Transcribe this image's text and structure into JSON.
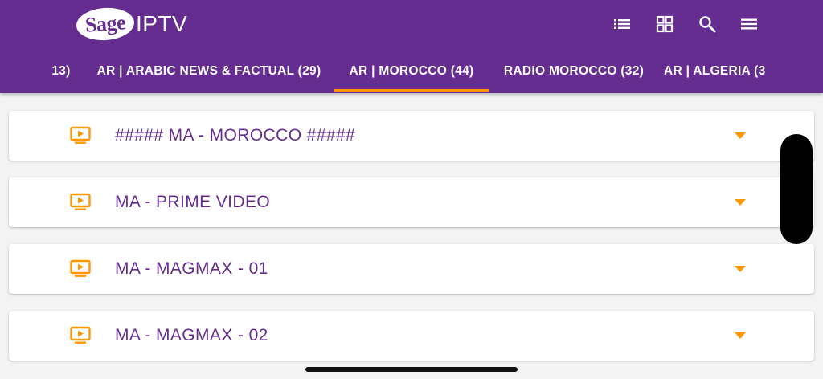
{
  "header": {
    "logo": {
      "part1": "Sage",
      "part2": "IPTV"
    },
    "actions": [
      {
        "icon": "list-view-icon"
      },
      {
        "icon": "grid-view-icon"
      },
      {
        "icon": "search-icon"
      },
      {
        "icon": "menu-icon"
      }
    ]
  },
  "tabs": [
    {
      "label": "13)"
    },
    {
      "label": "AR | ARABIC NEWS & FACTUAL (29)"
    },
    {
      "label": "AR | MOROCCO (44)",
      "selected": true
    },
    {
      "label": "RADIO MOROCCO (32)"
    },
    {
      "label": "AR | ALGERIA (3"
    }
  ],
  "channels": [
    {
      "name": "##### MA - MOROCCO #####",
      "icon": "tv-play-icon",
      "expand_icon": "dropdown-arrow-icon"
    },
    {
      "name": "MA - PRIME VIDEO",
      "icon": "tv-play-icon",
      "expand_icon": "dropdown-arrow-icon"
    },
    {
      "name": "MA - MAGMAX - 01",
      "icon": "tv-play-icon",
      "expand_icon": "dropdown-arrow-icon"
    },
    {
      "name": "MA - MAGMAX - 02",
      "icon": "tv-play-icon",
      "expand_icon": "dropdown-arrow-icon"
    }
  ],
  "colors": {
    "primary": "#652d90",
    "accent": "#ff9800",
    "background": "#f3f3f3",
    "card": "#ffffff"
  }
}
